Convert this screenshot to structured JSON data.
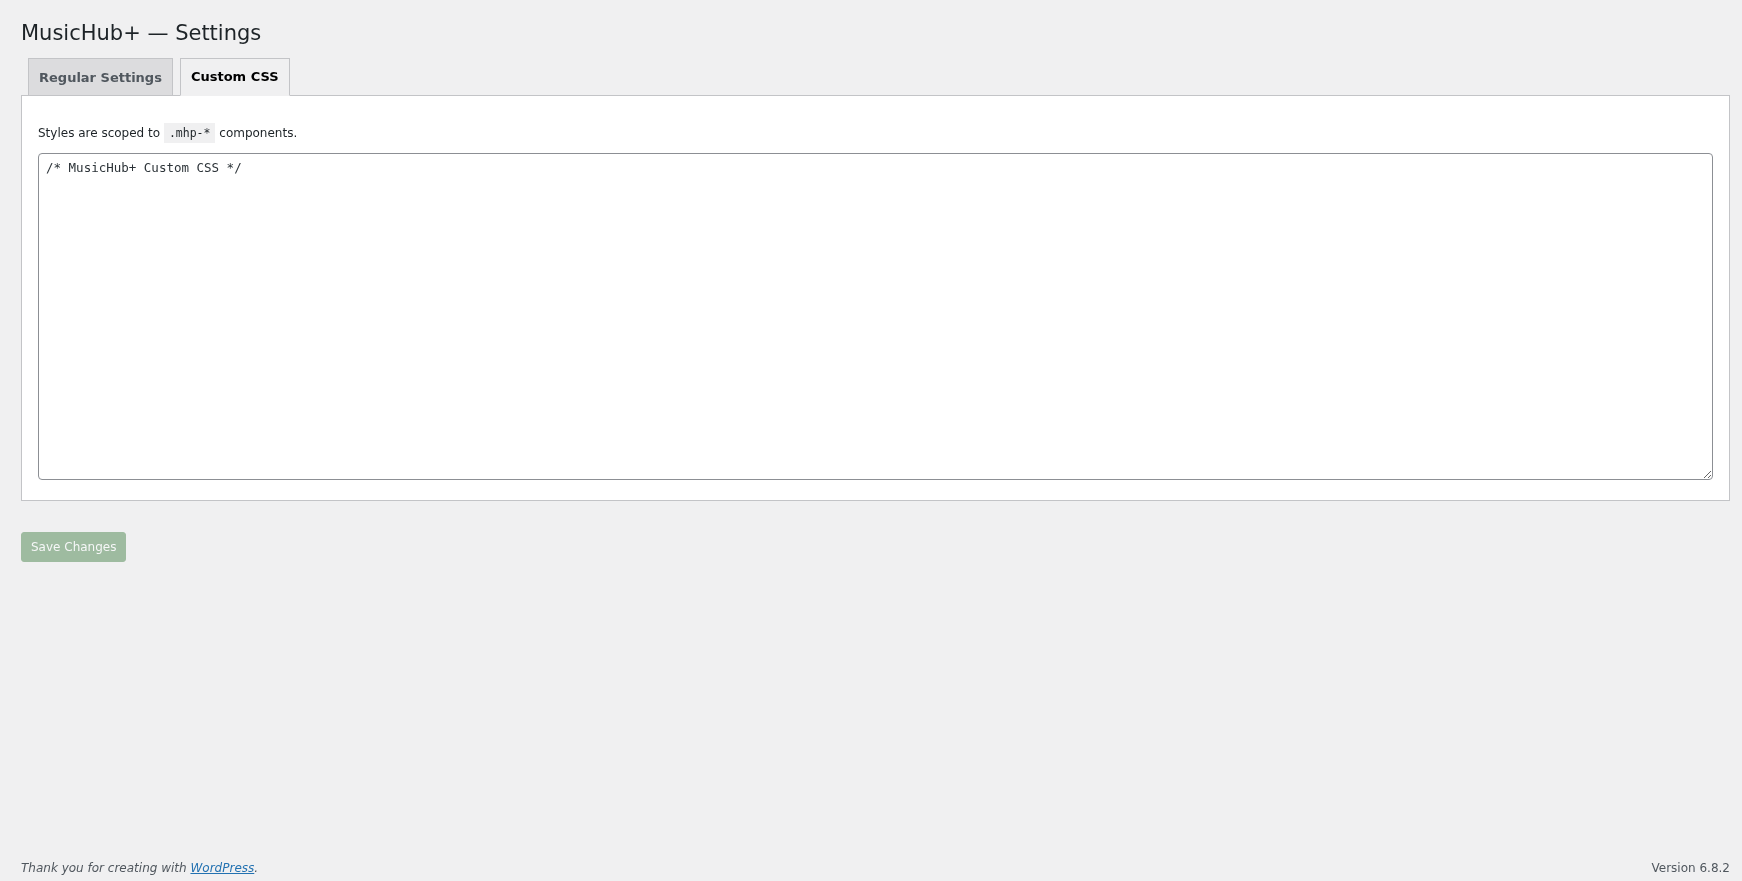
{
  "page": {
    "title": "MusicHub+ — Settings"
  },
  "tabs": [
    {
      "label": "Regular Settings",
      "selected": false
    },
    {
      "label": "Custom CSS",
      "selected": true
    }
  ],
  "panel": {
    "description": {
      "before": "Styles are scoped to",
      "code": ".mhp-*",
      "after": "components."
    },
    "editor": {
      "value": "/* MusicHub+ Custom CSS */"
    }
  },
  "save_button": {
    "label": "Save Changes",
    "disabled": true
  },
  "footer": {
    "before": "Thank you for creating with",
    "link": "WordPress",
    "after": ".",
    "version": "Version 6.8.2"
  }
}
